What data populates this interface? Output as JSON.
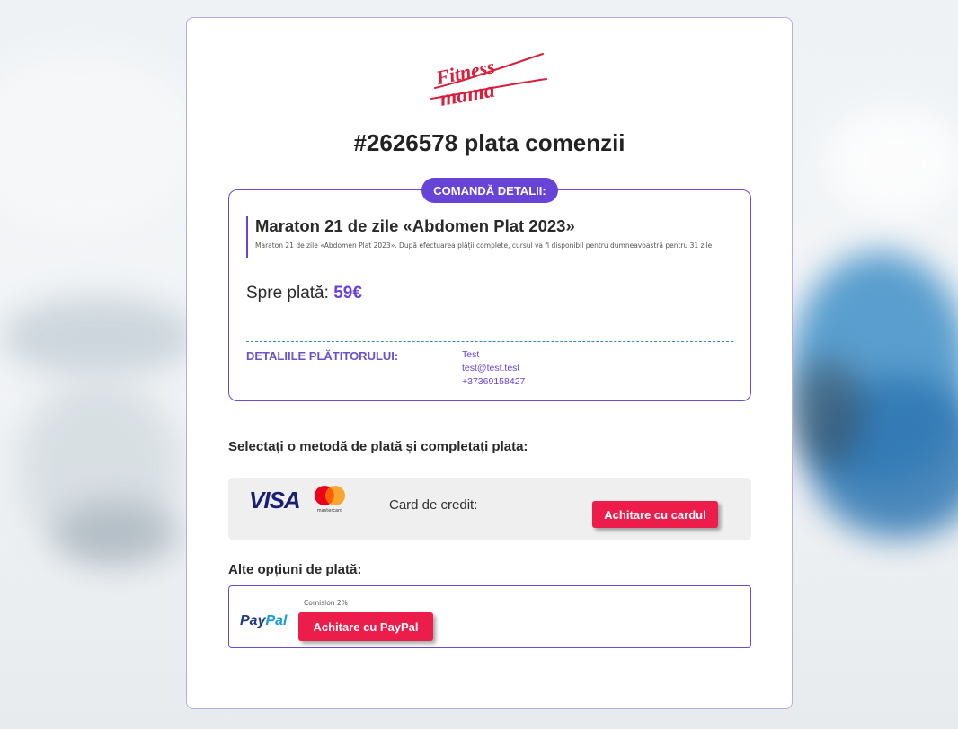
{
  "brand": {
    "logo_text": "Fitness mama",
    "accent": "#6743d8",
    "cta_color": "#ec1c4b"
  },
  "page": {
    "title": "#2626578 plata comenzii"
  },
  "order": {
    "badge": "COMANDĂ DETALII:",
    "product_name": "Maraton 21 de zile «Abdomen Plat 2023»",
    "product_description": "Maraton 21 de zile «Abdomen Plat 2023». După efectuarea plății complete, cursul va fi disponibil pentru dumneavoastră pentru 31 zile",
    "amount_label": "Spre plată:",
    "amount_value": "59€",
    "payer_label": "DETALIILE PLĂTITORULUI:",
    "payer_name": "Test",
    "payer_email": "test@test.test",
    "payer_phone": "+37369158427"
  },
  "payment": {
    "select_title": "Selectați o metodă de plată și completați plata:",
    "card_label": "Card de credit:",
    "visa_text": "VISA",
    "mastercard_text": "mastercard",
    "card_button": "Achitare cu cardul",
    "other_title": "Alte opțiuni de plată:",
    "paypal_pay": "Pay",
    "paypal_pal": "Pal",
    "commission": "Comision 2%",
    "paypal_button": "Achitare cu PayPal"
  }
}
